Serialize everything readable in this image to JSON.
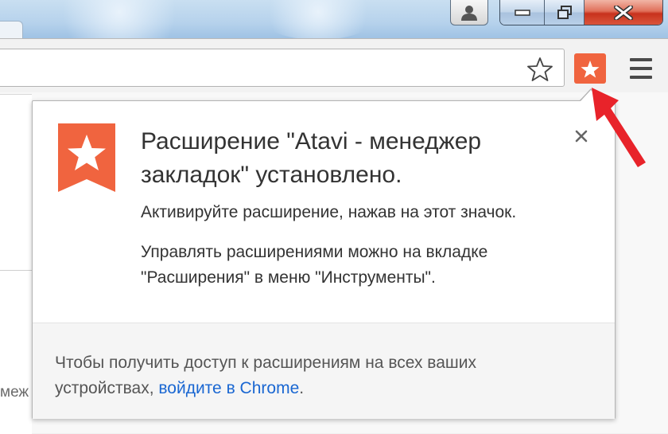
{
  "window": {
    "profile_icon": "user-icon",
    "minimize_icon": "minimize-icon",
    "maximize_icon": "restore-icon",
    "close_icon": "close-icon"
  },
  "toolbar": {
    "bookmark_icon": "star-outline-icon",
    "extension_icon": "atavi-star-icon",
    "menu_icon": "hamburger-menu-icon",
    "accent_color": "#f0643f"
  },
  "bubble": {
    "title": "Расширение \"Atavi - менеджер закладок\" установлено.",
    "activate_text": "Активируйте расширение, нажав на этот значок.",
    "manage_text": "Управлять расширениями можно на вкладке \"Расширения\" в меню \"Инструменты\".",
    "footer_prefix": "Чтобы получить доступ к расширениям на всех ваших устройствах, ",
    "footer_link": "войдите в Chrome",
    "footer_suffix": ".",
    "link_color": "#1a67d2"
  },
  "page": {
    "partial_text": "меж"
  },
  "annotation": {
    "arrow_color": "#e8232a"
  }
}
